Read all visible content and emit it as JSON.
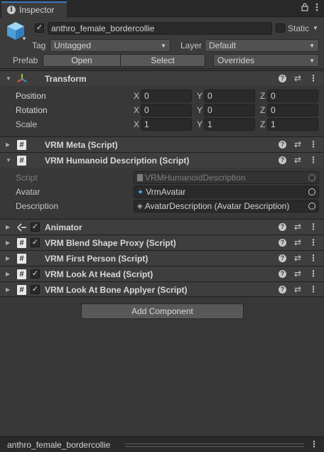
{
  "tab": {
    "title": "Inspector"
  },
  "header": {
    "active": true,
    "name": "anthro_female_bordercollie",
    "static_label": "Static",
    "tag_label": "Tag",
    "tag_value": "Untagged",
    "layer_label": "Layer",
    "layer_value": "Default",
    "prefab_label": "Prefab",
    "prefab_open": "Open",
    "prefab_select": "Select",
    "prefab_overrides": "Overrides"
  },
  "transform": {
    "title": "Transform",
    "rows": [
      {
        "label": "Position",
        "x": "0",
        "y": "0",
        "z": "0"
      },
      {
        "label": "Rotation",
        "x": "0",
        "y": "0",
        "z": "0"
      },
      {
        "label": "Scale",
        "x": "1",
        "y": "1",
        "z": "1"
      }
    ],
    "axis_x": "X",
    "axis_y": "Y",
    "axis_z": "Z"
  },
  "components": {
    "vrm_meta": "VRM Meta (Script)",
    "vrm_humanoid": "VRM Humanoid Description (Script)",
    "humanoid_fields": {
      "script_label": "Script",
      "script_value": "VRMHumanoidDescription",
      "avatar_label": "Avatar",
      "avatar_value": "VrmAvatar",
      "description_label": "Description",
      "description_value": "AvatarDescription (Avatar Description)"
    },
    "animator": "Animator",
    "blend_shape": "VRM Blend Shape Proxy (Script)",
    "first_person": "VRM First Person (Script)",
    "look_at_head": "VRM Look At Head (Script)",
    "look_at_bone": "VRM Look At Bone Applyer (Script)"
  },
  "add_component": "Add Component",
  "footer": {
    "name": "anthro_female_bordercollie"
  },
  "colors": {
    "accent": "#3a79bb",
    "background": "#383838",
    "header": "#3c3c3c"
  }
}
